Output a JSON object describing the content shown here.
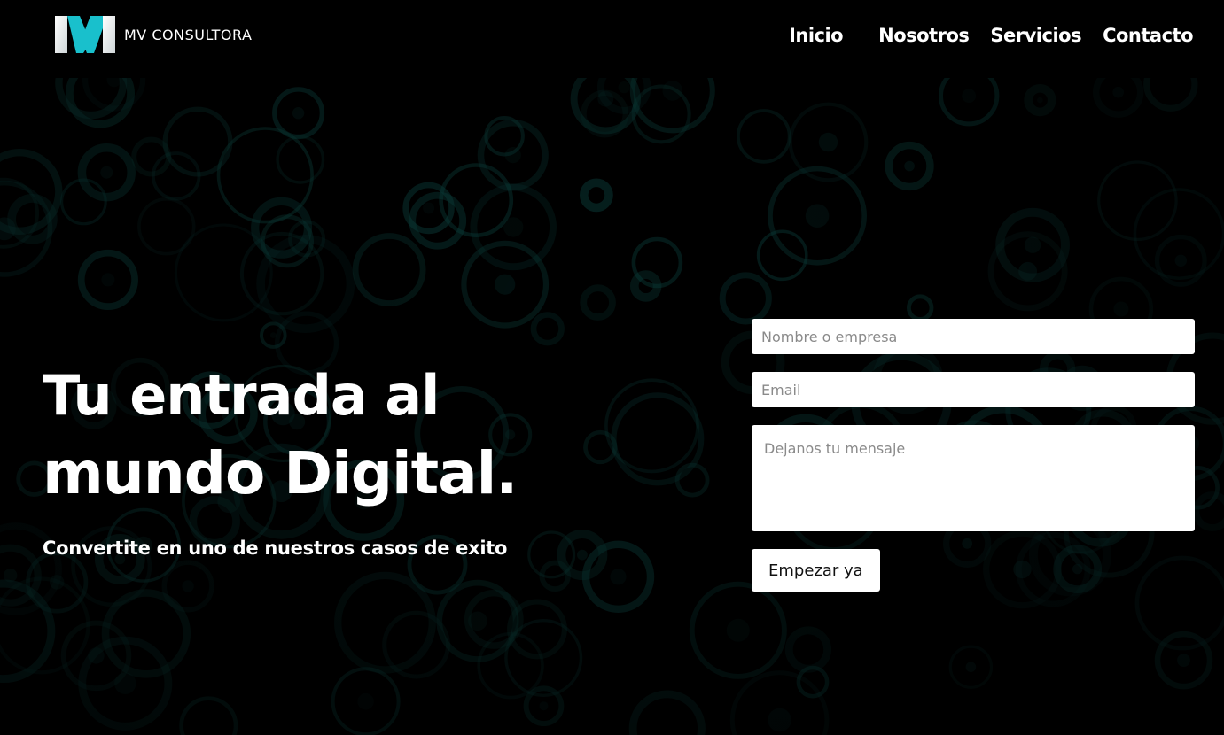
{
  "brand": {
    "logo_letter": "M",
    "name": "MV CONSULTORA",
    "accent_color": "#19c0cc"
  },
  "nav": {
    "items": [
      {
        "label": "Inicio"
      },
      {
        "label": "Nosotros"
      },
      {
        "label": "Servicios"
      },
      {
        "label": "Contacto"
      }
    ]
  },
  "hero": {
    "title_line1": "Tu entrada al",
    "title_line2": "mundo Digital.",
    "subtitle": "Convertite en uno de nuestros casos de exito"
  },
  "form": {
    "name_placeholder": "Nombre o empresa",
    "email_placeholder": "Email",
    "message_placeholder": "Dejanos tu mensaje",
    "submit_label": "Empezar ya"
  },
  "background": {
    "ring_color": "#0f5a55"
  }
}
